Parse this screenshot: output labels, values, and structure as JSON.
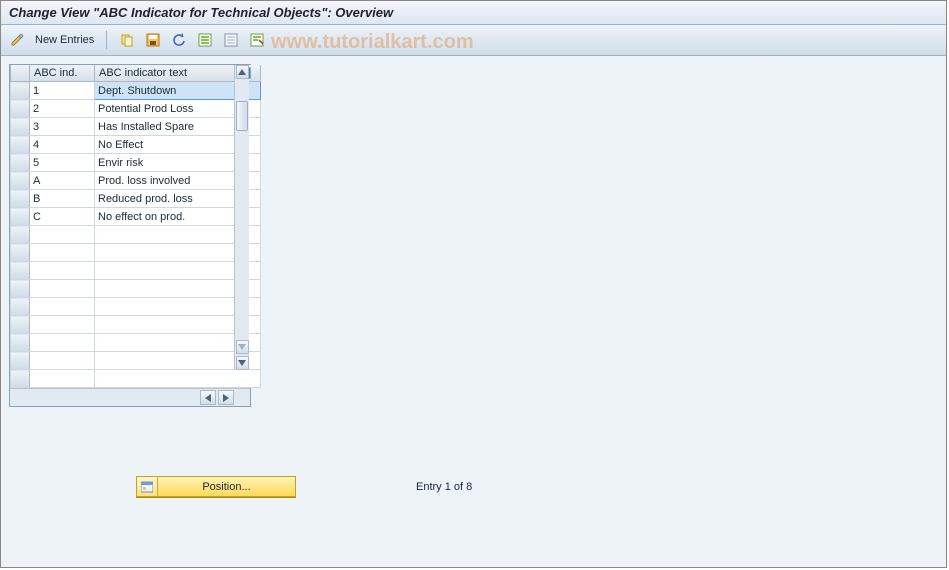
{
  "title": "Change View \"ABC Indicator for Technical Objects\": Overview",
  "watermark": "www.tutorialkart.com",
  "toolbar": {
    "new_entries_label": "New Entries"
  },
  "table": {
    "headers": {
      "ind": "ABC ind.",
      "text": "ABC indicator text"
    },
    "rows": [
      {
        "ind": "1",
        "text": "Dept. Shutdown",
        "selected": true
      },
      {
        "ind": "2",
        "text": "Potential Prod Loss"
      },
      {
        "ind": "3",
        "text": "Has Installed Spare"
      },
      {
        "ind": "4",
        "text": "No Effect"
      },
      {
        "ind": "5",
        "text": "Envir risk"
      },
      {
        "ind": "A",
        "text": "Prod. loss involved"
      },
      {
        "ind": "B",
        "text": "Reduced prod. loss"
      },
      {
        "ind": "C",
        "text": "No effect on prod."
      }
    ],
    "blank_rows": 9
  },
  "footer": {
    "position_label": "Position...",
    "entry_text": "Entry 1 of 8"
  }
}
